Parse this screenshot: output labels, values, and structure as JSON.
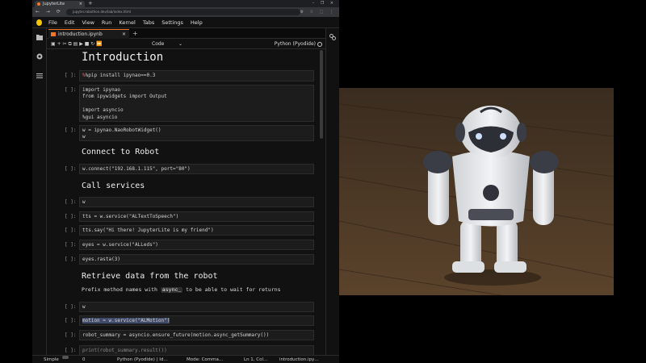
{
  "browser": {
    "tab_title": "JupyterLite",
    "tab_close": "×",
    "new_tab": "+",
    "window_controls": "– ❐ ×",
    "nav": "← → ⟳",
    "url": "jupyter.robothon.dev/lab/index.html",
    "extensions": "⚙ ☆ ⬚ ⋮"
  },
  "menu": [
    "File",
    "Edit",
    "View",
    "Run",
    "Kernel",
    "Tabs",
    "Settings",
    "Help"
  ],
  "notebook_tab": {
    "title": "introduction.ipynb",
    "close": "×",
    "add": "+"
  },
  "toolbar": {
    "buttons": "▣ + ✂ ⧉ ▤ ▶ ■ ↻ ⏩",
    "cell_type": "Code",
    "cell_type_chevron": "⌄",
    "kernel": "Python (Pyodide)"
  },
  "notebook": {
    "title": "Introduction",
    "prompt": "[ ]:",
    "cells": [
      "%pip install ipynao==0.3",
      "import ipynao\nfrom ipywidgets import Output\n\nimport asyncio\n%gui asyncio",
      "w = ipynao.NaoRobotWidget()\nw",
      "w.connect(\"192.168.1.115\", port=\"80\")",
      "w",
      "tts = w.service(\"ALTextToSpeech\")",
      "tts.say(\"Hi there! JupyterLite is my friend\")",
      "eyes = w.service(\"ALLeds\")",
      "eyes.rasta(3)",
      "w",
      "motion = w.service(\"ALMotion\")",
      "robot_summary = asyncio.ensure_future(motion.async_getSummary())",
      "print(robot_summary.result())"
    ],
    "heading_connect": "Connect to Robot",
    "heading_services": "Call services",
    "heading_retrieve": "Retrieve data from the robot",
    "para_prefix": "Prefix method names with",
    "para_code": "async_",
    "para_suffix": "to be able to wait for returns"
  },
  "statusbar": {
    "mode_label": "Simple",
    "count": "0",
    "kernel": "Python (Pyodide) | Id…",
    "mode": "Mode: Comma…",
    "position": "Ln 1, Col…",
    "file": "introduction.ipy…"
  },
  "colors": {
    "accent": "#f37726",
    "logo": "#f5c600",
    "background": "#111111"
  },
  "icons": [
    "jupyter-logo-icon",
    "folder-icon",
    "running-icon",
    "toc-icon",
    "property-inspector-icon"
  ]
}
